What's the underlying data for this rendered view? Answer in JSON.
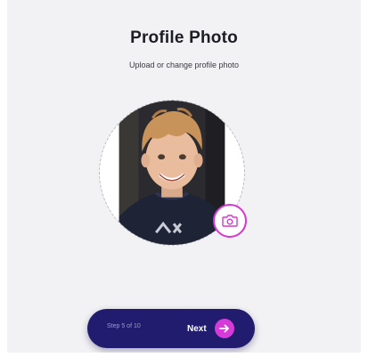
{
  "header": {
    "title": "Profile Photo",
    "subtitle": "Upload or change profile photo"
  },
  "photo": {
    "icon": "camera-icon"
  },
  "footer": {
    "step_text": "Step 5 of 10",
    "next_label": "Next",
    "next_icon": "arrow-right-icon"
  },
  "colors": {
    "background": "#f2f2f4",
    "footer_bar": "#211c6e",
    "accent": "#d63ad8"
  }
}
